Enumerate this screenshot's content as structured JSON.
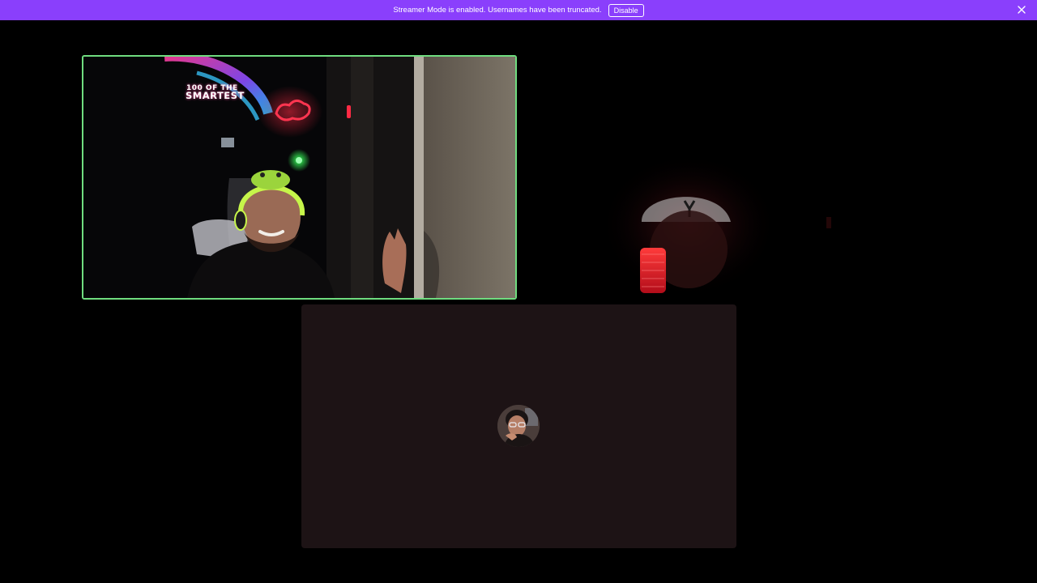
{
  "banner": {
    "message": "Streamer Mode is enabled. Usernames have been truncated.",
    "disable_label": "Disable",
    "close_icon": "close-icon",
    "background_color": "#8a3ffc"
  },
  "call": {
    "speaking_indicator_color": "#6fdc7f",
    "tiles": [
      {
        "id": "speaking-participant",
        "state": "video-on",
        "speaking": true,
        "overlay": {
          "line1": "100 OF THE",
          "line2": "SMARTEST"
        }
      },
      {
        "id": "participant-cap",
        "state": "video-on",
        "speaking": false
      },
      {
        "id": "participant-avatar",
        "state": "video-off",
        "speaking": false,
        "avatar_icon": "user-avatar",
        "background_color": "#1d1315"
      }
    ]
  }
}
